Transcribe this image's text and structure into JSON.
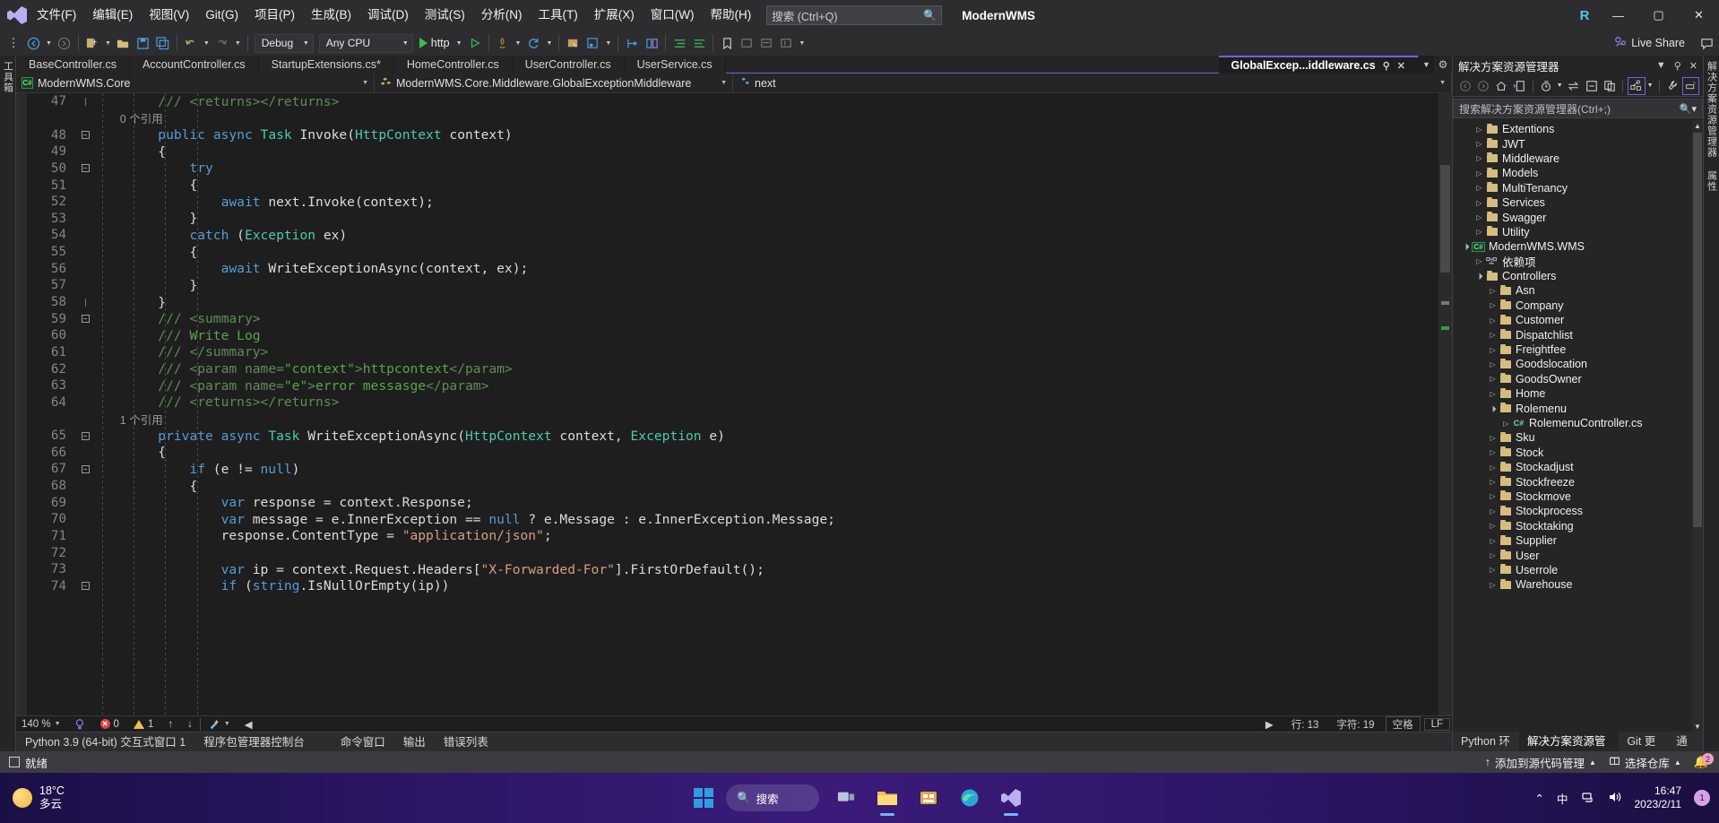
{
  "titlebar": {
    "logo_icon": "vs-logo-icon",
    "menus": [
      "文件(F)",
      "编辑(E)",
      "视图(V)",
      "Git(G)",
      "项目(P)",
      "生成(B)",
      "调试(D)",
      "测试(S)",
      "分析(N)",
      "工具(T)",
      "扩展(X)",
      "窗口(W)",
      "帮助(H)"
    ],
    "search_placeholder": "搜索 (Ctrl+Q)",
    "search_icon": "search-icon",
    "project_name": "ModernWMS",
    "account_initial": "R",
    "minimize": "—",
    "maximize": "▢",
    "close": "✕"
  },
  "toolbar": {
    "nav_back_icon": "navigate-back-icon",
    "nav_forward_icon": "navigate-forward-icon",
    "new_project_icon": "new-project-icon",
    "open_icon": "open-file-icon",
    "save_icon": "save-icon",
    "save_all_icon": "save-all-icon",
    "undo_icon": "undo-icon",
    "redo_icon": "redo-icon",
    "config_value": "Debug",
    "platform_value": "Any CPU",
    "run_label": "http",
    "start_icon": "start-debug-icon",
    "start_no_debug_icon": "start-without-debugging-icon",
    "hot_reload_icon": "hot-reload-icon",
    "refresh_icon": "refresh-icon",
    "live_share_label": "Live Share",
    "live_share_icon": "live-share-icon"
  },
  "left_rail": {
    "label": "工具箱"
  },
  "right_rail": {
    "labels": [
      "解决方案资源管理器",
      "属性"
    ]
  },
  "editor_tabs": {
    "tabs": [
      {
        "label": "BaseController.cs",
        "active": false
      },
      {
        "label": "AccountController.cs",
        "active": false
      },
      {
        "label": "StartupExtensions.cs*",
        "active": false
      },
      {
        "label": "HomeController.cs",
        "active": false
      },
      {
        "label": "UserController.cs",
        "active": false
      },
      {
        "label": "UserService.cs",
        "active": false
      }
    ],
    "active_tab": {
      "label": "GlobalExcep...iddleware.cs",
      "pin_icon": "pin-icon",
      "close_icon": "close-icon"
    },
    "dropdown_icon": "chevron-down-icon",
    "gear_icon": "gear-icon"
  },
  "navbar": {
    "project": "ModernWMS.Core",
    "project_icon": "csharp-project-icon",
    "type": "ModernWMS.Core.Middleware.GlobalExceptionMiddleware",
    "type_icon": "class-icon",
    "member": "next",
    "member_icon": "field-icon"
  },
  "code": {
    "lines": [
      {
        "n": 47,
        "fold": "end",
        "indent": 8,
        "segs": [
          {
            "t": "/// ",
            "c": "cmx"
          },
          {
            "t": "<returns></returns>",
            "c": "cmx"
          }
        ]
      },
      {
        "n": "",
        "fold": "",
        "indent": 8,
        "ref": "0 个引用"
      },
      {
        "n": 48,
        "fold": "minus",
        "indent": 8,
        "segs": [
          {
            "t": "public ",
            "c": "kw"
          },
          {
            "t": "async ",
            "c": "kw"
          },
          {
            "t": "Task",
            "c": "ty"
          },
          {
            "t": " Invoke(",
            "c": "pl"
          },
          {
            "t": "HttpContext",
            "c": "ty"
          },
          {
            "t": " context)",
            "c": "pl"
          }
        ]
      },
      {
        "n": 49,
        "fold": "",
        "indent": 8,
        "segs": [
          {
            "t": "{",
            "c": "pl"
          }
        ]
      },
      {
        "n": 50,
        "fold": "minus",
        "indent": 12,
        "segs": [
          {
            "t": "try",
            "c": "kw"
          }
        ]
      },
      {
        "n": 51,
        "fold": "",
        "indent": 12,
        "segs": [
          {
            "t": "{",
            "c": "pl"
          }
        ]
      },
      {
        "n": 52,
        "fold": "",
        "indent": 16,
        "segs": [
          {
            "t": "await",
            "c": "kw"
          },
          {
            "t": " next.Invoke(context);",
            "c": "pl"
          }
        ]
      },
      {
        "n": 53,
        "fold": "",
        "indent": 12,
        "segs": [
          {
            "t": "}",
            "c": "pl"
          }
        ]
      },
      {
        "n": 54,
        "fold": "",
        "indent": 12,
        "segs": [
          {
            "t": "catch ",
            "c": "kw"
          },
          {
            "t": "(",
            "c": "pl"
          },
          {
            "t": "Exception",
            "c": "ty"
          },
          {
            "t": " ex)",
            "c": "pl"
          }
        ]
      },
      {
        "n": 55,
        "fold": "",
        "indent": 12,
        "segs": [
          {
            "t": "{",
            "c": "pl"
          }
        ]
      },
      {
        "n": 56,
        "fold": "",
        "indent": 16,
        "segs": [
          {
            "t": "await",
            "c": "kw"
          },
          {
            "t": " WriteExceptionAsync(context, ex);",
            "c": "pl"
          }
        ]
      },
      {
        "n": 57,
        "fold": "",
        "indent": 12,
        "segs": [
          {
            "t": "}",
            "c": "pl"
          }
        ]
      },
      {
        "n": 58,
        "fold": "end",
        "indent": 8,
        "segs": [
          {
            "t": "}",
            "c": "pl"
          }
        ]
      },
      {
        "n": 59,
        "fold": "minus",
        "indent": 8,
        "segs": [
          {
            "t": "/// ",
            "c": "cmx"
          },
          {
            "t": "<summary>",
            "c": "cmx"
          }
        ]
      },
      {
        "n": 60,
        "fold": "",
        "indent": 8,
        "segs": [
          {
            "t": "/// ",
            "c": "cmx"
          },
          {
            "t": "Write Log",
            "c": "cm"
          }
        ]
      },
      {
        "n": 61,
        "fold": "",
        "indent": 8,
        "segs": [
          {
            "t": "/// ",
            "c": "cmx"
          },
          {
            "t": "</summary>",
            "c": "cmx"
          }
        ]
      },
      {
        "n": 62,
        "fold": "",
        "indent": 8,
        "segs": [
          {
            "t": "/// ",
            "c": "cmx"
          },
          {
            "t": "<param name=",
            "c": "cmx"
          },
          {
            "t": "\"context\"",
            "c": "cm"
          },
          {
            "t": ">",
            "c": "cmx"
          },
          {
            "t": "httpcontext",
            "c": "cm"
          },
          {
            "t": "</param>",
            "c": "cmx"
          }
        ]
      },
      {
        "n": 63,
        "fold": "",
        "indent": 8,
        "segs": [
          {
            "t": "/// ",
            "c": "cmx"
          },
          {
            "t": "<param name=",
            "c": "cmx"
          },
          {
            "t": "\"e\"",
            "c": "cm"
          },
          {
            "t": ">",
            "c": "cmx"
          },
          {
            "t": "error messasge",
            "c": "cm"
          },
          {
            "t": "</param>",
            "c": "cmx"
          }
        ]
      },
      {
        "n": 64,
        "fold": "",
        "indent": 8,
        "segs": [
          {
            "t": "/// ",
            "c": "cmx"
          },
          {
            "t": "<returns></returns>",
            "c": "cmx"
          }
        ]
      },
      {
        "n": "",
        "fold": "",
        "indent": 8,
        "ref": "1 个引用"
      },
      {
        "n": 65,
        "fold": "minus",
        "indent": 8,
        "segs": [
          {
            "t": "private ",
            "c": "kw"
          },
          {
            "t": "async ",
            "c": "kw"
          },
          {
            "t": "Task",
            "c": "ty"
          },
          {
            "t": " WriteExceptionAsync(",
            "c": "pl"
          },
          {
            "t": "HttpContext",
            "c": "ty"
          },
          {
            "t": " context, ",
            "c": "pl"
          },
          {
            "t": "Exception",
            "c": "ty"
          },
          {
            "t": " e)",
            "c": "pl"
          }
        ]
      },
      {
        "n": 66,
        "fold": "",
        "indent": 8,
        "segs": [
          {
            "t": "{",
            "c": "pl"
          }
        ]
      },
      {
        "n": 67,
        "fold": "minus",
        "indent": 12,
        "segs": [
          {
            "t": "if ",
            "c": "kw"
          },
          {
            "t": "(e != ",
            "c": "pl"
          },
          {
            "t": "null",
            "c": "kw"
          },
          {
            "t": ")",
            "c": "pl"
          }
        ]
      },
      {
        "n": 68,
        "fold": "",
        "indent": 12,
        "segs": [
          {
            "t": "{",
            "c": "pl"
          }
        ]
      },
      {
        "n": 69,
        "fold": "",
        "indent": 16,
        "segs": [
          {
            "t": "var",
            "c": "kw"
          },
          {
            "t": " response = context.Response;",
            "c": "pl"
          }
        ]
      },
      {
        "n": 70,
        "fold": "",
        "indent": 16,
        "segs": [
          {
            "t": "var",
            "c": "kw"
          },
          {
            "t": " message = e.InnerException == ",
            "c": "pl"
          },
          {
            "t": "null",
            "c": "kw"
          },
          {
            "t": " ? e.Message : e.InnerException.Message;",
            "c": "pl"
          }
        ]
      },
      {
        "n": 71,
        "fold": "",
        "indent": 16,
        "segs": [
          {
            "t": "response.ContentType = ",
            "c": "pl"
          },
          {
            "t": "\"application/json\"",
            "c": "str"
          },
          {
            "t": ";",
            "c": "pl"
          }
        ]
      },
      {
        "n": 72,
        "fold": "",
        "indent": 16,
        "segs": []
      },
      {
        "n": 73,
        "fold": "",
        "indent": 16,
        "segs": [
          {
            "t": "var",
            "c": "kw"
          },
          {
            "t": " ip = context.Request.Headers[",
            "c": "pl"
          },
          {
            "t": "\"X-Forwarded-For\"",
            "c": "str"
          },
          {
            "t": "].FirstOrDefault();",
            "c": "pl"
          }
        ]
      },
      {
        "n": 74,
        "fold": "minus",
        "indent": 16,
        "segs": [
          {
            "t": "if ",
            "c": "kw"
          },
          {
            "t": "(",
            "c": "pl"
          },
          {
            "t": "string",
            "c": "kw"
          },
          {
            "t": ".IsNullOrEmpty(ip))",
            "c": "pl"
          }
        ]
      }
    ]
  },
  "editor_status": {
    "zoom": "140 %",
    "zoom_caret_icon": "chevron-down-icon",
    "intellicode_icon": "intellicode-icon",
    "error_count": "0",
    "warning_count": "1",
    "up_icon": "arrow-up-icon",
    "down_icon": "arrow-down-icon",
    "cleanup_icon": "code-cleanup-icon",
    "scroll_left_icon": "scroll-left-icon",
    "line_label": "行: 13",
    "char_label": "字符: 19",
    "space_label": "空格",
    "eol_label": "LF",
    "expand_icon": "chevron-right-icon"
  },
  "bottom_tool_tabs": {
    "tabs": [
      "Python 3.9 (64-bit) 交互式窗口 1",
      "程序包管理器控制台",
      "命令窗口",
      "输出",
      "错误列表"
    ]
  },
  "solution_explorer": {
    "title": "解决方案资源管理器",
    "header_icons": [
      "chevron-down-icon",
      "pin-icon",
      "close-icon"
    ],
    "toolbar_icons": [
      "back-icon",
      "forward-icon",
      "home-icon",
      "collapse-all-to-definitions-icon",
      "pending-changes-icon",
      "sync-with-active-document-icon",
      "collapse-all-icon",
      "show-all-files-icon",
      "solution-view-icon",
      "properties-icon",
      "preview-selected-items-icon"
    ],
    "search_placeholder": "搜索解决方案资源管理器(Ctrl+;)",
    "search_icon": "search-icon",
    "tree": [
      {
        "label": "Extentions",
        "depth": 2,
        "icon": "folder",
        "state": "collapsed"
      },
      {
        "label": "JWT",
        "depth": 2,
        "icon": "folder",
        "state": "collapsed"
      },
      {
        "label": "Middleware",
        "depth": 2,
        "icon": "folder",
        "state": "collapsed"
      },
      {
        "label": "Models",
        "depth": 2,
        "icon": "folder",
        "state": "collapsed"
      },
      {
        "label": "MultiTenancy",
        "depth": 2,
        "icon": "folder",
        "state": "collapsed"
      },
      {
        "label": "Services",
        "depth": 2,
        "icon": "folder",
        "state": "collapsed"
      },
      {
        "label": "Swagger",
        "depth": 2,
        "icon": "folder",
        "state": "collapsed"
      },
      {
        "label": "Utility",
        "depth": 2,
        "icon": "folder",
        "state": "collapsed"
      },
      {
        "label": "ModernWMS.WMS",
        "depth": 1,
        "icon": "csproj",
        "state": "expanded"
      },
      {
        "label": "依赖项",
        "depth": 2,
        "icon": "deps",
        "state": "collapsed"
      },
      {
        "label": "Controllers",
        "depth": 2,
        "icon": "folder",
        "state": "expanded"
      },
      {
        "label": "Asn",
        "depth": 3,
        "icon": "folder",
        "state": "collapsed"
      },
      {
        "label": "Company",
        "depth": 3,
        "icon": "folder",
        "state": "collapsed"
      },
      {
        "label": "Customer",
        "depth": 3,
        "icon": "folder",
        "state": "collapsed"
      },
      {
        "label": "Dispatchlist",
        "depth": 3,
        "icon": "folder",
        "state": "collapsed"
      },
      {
        "label": "Freightfee",
        "depth": 3,
        "icon": "folder",
        "state": "collapsed"
      },
      {
        "label": "Goodslocation",
        "depth": 3,
        "icon": "folder",
        "state": "collapsed"
      },
      {
        "label": "GoodsOwner",
        "depth": 3,
        "icon": "folder",
        "state": "collapsed"
      },
      {
        "label": "Home",
        "depth": 3,
        "icon": "folder",
        "state": "collapsed"
      },
      {
        "label": "Rolemenu",
        "depth": 3,
        "icon": "folder",
        "state": "expanded"
      },
      {
        "label": "RolemenuController.cs",
        "depth": 4,
        "icon": "cs",
        "state": "collapsed"
      },
      {
        "label": "Sku",
        "depth": 3,
        "icon": "folder",
        "state": "collapsed"
      },
      {
        "label": "Stock",
        "depth": 3,
        "icon": "folder",
        "state": "collapsed"
      },
      {
        "label": "Stockadjust",
        "depth": 3,
        "icon": "folder",
        "state": "collapsed"
      },
      {
        "label": "Stockfreeze",
        "depth": 3,
        "icon": "folder",
        "state": "collapsed"
      },
      {
        "label": "Stockmove",
        "depth": 3,
        "icon": "folder",
        "state": "collapsed"
      },
      {
        "label": "Stockprocess",
        "depth": 3,
        "icon": "folder",
        "state": "collapsed"
      },
      {
        "label": "Stocktaking",
        "depth": 3,
        "icon": "folder",
        "state": "collapsed"
      },
      {
        "label": "Supplier",
        "depth": 3,
        "icon": "folder",
        "state": "collapsed"
      },
      {
        "label": "User",
        "depth": 3,
        "icon": "folder",
        "state": "collapsed"
      },
      {
        "label": "Userrole",
        "depth": 3,
        "icon": "folder",
        "state": "collapsed"
      },
      {
        "label": "Warehouse",
        "depth": 3,
        "icon": "folder",
        "state": "collapsed"
      }
    ],
    "bottom_tabs": [
      {
        "label": "Python 环境",
        "active": false
      },
      {
        "label": "解决方案资源管理器",
        "active": true
      },
      {
        "label": "Git 更改",
        "active": false
      },
      {
        "label": "通知",
        "active": false
      }
    ]
  },
  "statusbar": {
    "ready": "就绪",
    "add_to_source_control": "添加到源代码管理",
    "add_icon": "upload-icon",
    "select_repo": "选择仓库",
    "repo_icon": "repository-icon",
    "caret_icon": "caret-up-icon",
    "bell_icon": "bell-icon",
    "bell_count": "2"
  },
  "taskbar": {
    "weather_temp": "18°C",
    "weather_desc": "多云",
    "weather_icon": "sun-cloud-icon",
    "start_icon": "windows-start-icon",
    "search_label": "搜索",
    "search_icon": "search-icon",
    "apps": [
      "task-view-icon",
      "file-explorer-icon",
      "store-icon",
      "edge-browser-icon",
      "visual-studio-icon"
    ],
    "tray_chevron_icon": "chevron-up-icon",
    "ime_label": "中",
    "network_icon": "network-icon",
    "volume_icon": "volume-icon",
    "time": "16:47",
    "date": "2023/2/11",
    "notification_count": "1"
  },
  "colors": {
    "accent": "#7160e8",
    "tab_active_underline": "#7160e8",
    "error": "#e04343",
    "warning": "#e6c44d",
    "taskbar": "#2a1563"
  }
}
